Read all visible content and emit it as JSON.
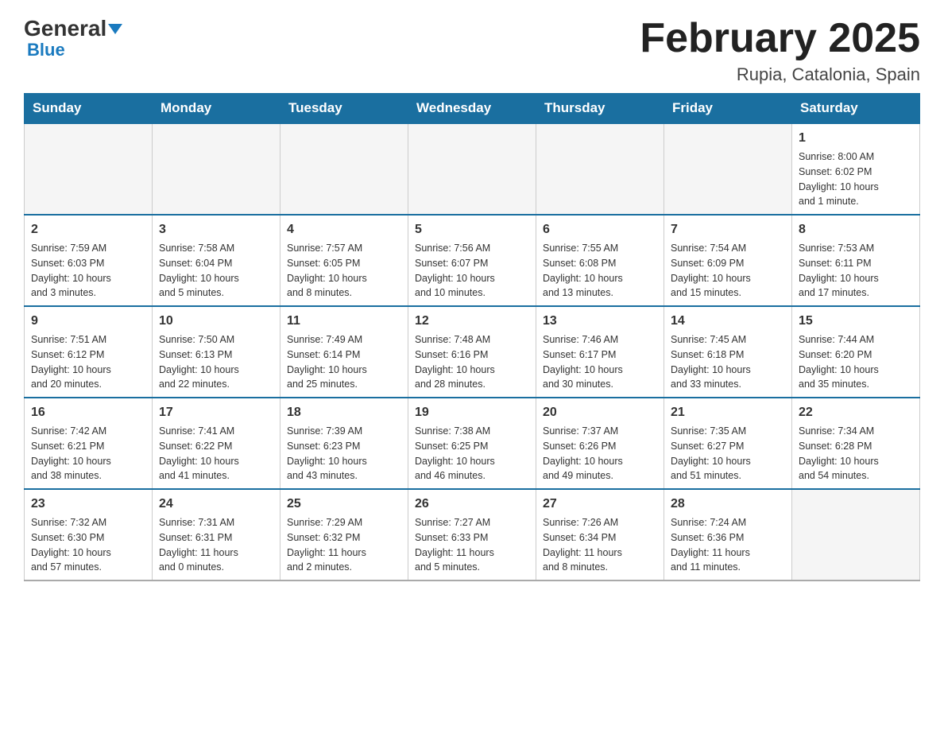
{
  "header": {
    "logo_general": "General",
    "logo_blue": "Blue",
    "title": "February 2025",
    "location": "Rupia, Catalonia, Spain"
  },
  "days_of_week": [
    "Sunday",
    "Monday",
    "Tuesday",
    "Wednesday",
    "Thursday",
    "Friday",
    "Saturday"
  ],
  "weeks": [
    [
      {
        "day": "",
        "info": ""
      },
      {
        "day": "",
        "info": ""
      },
      {
        "day": "",
        "info": ""
      },
      {
        "day": "",
        "info": ""
      },
      {
        "day": "",
        "info": ""
      },
      {
        "day": "",
        "info": ""
      },
      {
        "day": "1",
        "info": "Sunrise: 8:00 AM\nSunset: 6:02 PM\nDaylight: 10 hours\nand 1 minute."
      }
    ],
    [
      {
        "day": "2",
        "info": "Sunrise: 7:59 AM\nSunset: 6:03 PM\nDaylight: 10 hours\nand 3 minutes."
      },
      {
        "day": "3",
        "info": "Sunrise: 7:58 AM\nSunset: 6:04 PM\nDaylight: 10 hours\nand 5 minutes."
      },
      {
        "day": "4",
        "info": "Sunrise: 7:57 AM\nSunset: 6:05 PM\nDaylight: 10 hours\nand 8 minutes."
      },
      {
        "day": "5",
        "info": "Sunrise: 7:56 AM\nSunset: 6:07 PM\nDaylight: 10 hours\nand 10 minutes."
      },
      {
        "day": "6",
        "info": "Sunrise: 7:55 AM\nSunset: 6:08 PM\nDaylight: 10 hours\nand 13 minutes."
      },
      {
        "day": "7",
        "info": "Sunrise: 7:54 AM\nSunset: 6:09 PM\nDaylight: 10 hours\nand 15 minutes."
      },
      {
        "day": "8",
        "info": "Sunrise: 7:53 AM\nSunset: 6:11 PM\nDaylight: 10 hours\nand 17 minutes."
      }
    ],
    [
      {
        "day": "9",
        "info": "Sunrise: 7:51 AM\nSunset: 6:12 PM\nDaylight: 10 hours\nand 20 minutes."
      },
      {
        "day": "10",
        "info": "Sunrise: 7:50 AM\nSunset: 6:13 PM\nDaylight: 10 hours\nand 22 minutes."
      },
      {
        "day": "11",
        "info": "Sunrise: 7:49 AM\nSunset: 6:14 PM\nDaylight: 10 hours\nand 25 minutes."
      },
      {
        "day": "12",
        "info": "Sunrise: 7:48 AM\nSunset: 6:16 PM\nDaylight: 10 hours\nand 28 minutes."
      },
      {
        "day": "13",
        "info": "Sunrise: 7:46 AM\nSunset: 6:17 PM\nDaylight: 10 hours\nand 30 minutes."
      },
      {
        "day": "14",
        "info": "Sunrise: 7:45 AM\nSunset: 6:18 PM\nDaylight: 10 hours\nand 33 minutes."
      },
      {
        "day": "15",
        "info": "Sunrise: 7:44 AM\nSunset: 6:20 PM\nDaylight: 10 hours\nand 35 minutes."
      }
    ],
    [
      {
        "day": "16",
        "info": "Sunrise: 7:42 AM\nSunset: 6:21 PM\nDaylight: 10 hours\nand 38 minutes."
      },
      {
        "day": "17",
        "info": "Sunrise: 7:41 AM\nSunset: 6:22 PM\nDaylight: 10 hours\nand 41 minutes."
      },
      {
        "day": "18",
        "info": "Sunrise: 7:39 AM\nSunset: 6:23 PM\nDaylight: 10 hours\nand 43 minutes."
      },
      {
        "day": "19",
        "info": "Sunrise: 7:38 AM\nSunset: 6:25 PM\nDaylight: 10 hours\nand 46 minutes."
      },
      {
        "day": "20",
        "info": "Sunrise: 7:37 AM\nSunset: 6:26 PM\nDaylight: 10 hours\nand 49 minutes."
      },
      {
        "day": "21",
        "info": "Sunrise: 7:35 AM\nSunset: 6:27 PM\nDaylight: 10 hours\nand 51 minutes."
      },
      {
        "day": "22",
        "info": "Sunrise: 7:34 AM\nSunset: 6:28 PM\nDaylight: 10 hours\nand 54 minutes."
      }
    ],
    [
      {
        "day": "23",
        "info": "Sunrise: 7:32 AM\nSunset: 6:30 PM\nDaylight: 10 hours\nand 57 minutes."
      },
      {
        "day": "24",
        "info": "Sunrise: 7:31 AM\nSunset: 6:31 PM\nDaylight: 11 hours\nand 0 minutes."
      },
      {
        "day": "25",
        "info": "Sunrise: 7:29 AM\nSunset: 6:32 PM\nDaylight: 11 hours\nand 2 minutes."
      },
      {
        "day": "26",
        "info": "Sunrise: 7:27 AM\nSunset: 6:33 PM\nDaylight: 11 hours\nand 5 minutes."
      },
      {
        "day": "27",
        "info": "Sunrise: 7:26 AM\nSunset: 6:34 PM\nDaylight: 11 hours\nand 8 minutes."
      },
      {
        "day": "28",
        "info": "Sunrise: 7:24 AM\nSunset: 6:36 PM\nDaylight: 11 hours\nand 11 minutes."
      },
      {
        "day": "",
        "info": ""
      }
    ]
  ]
}
